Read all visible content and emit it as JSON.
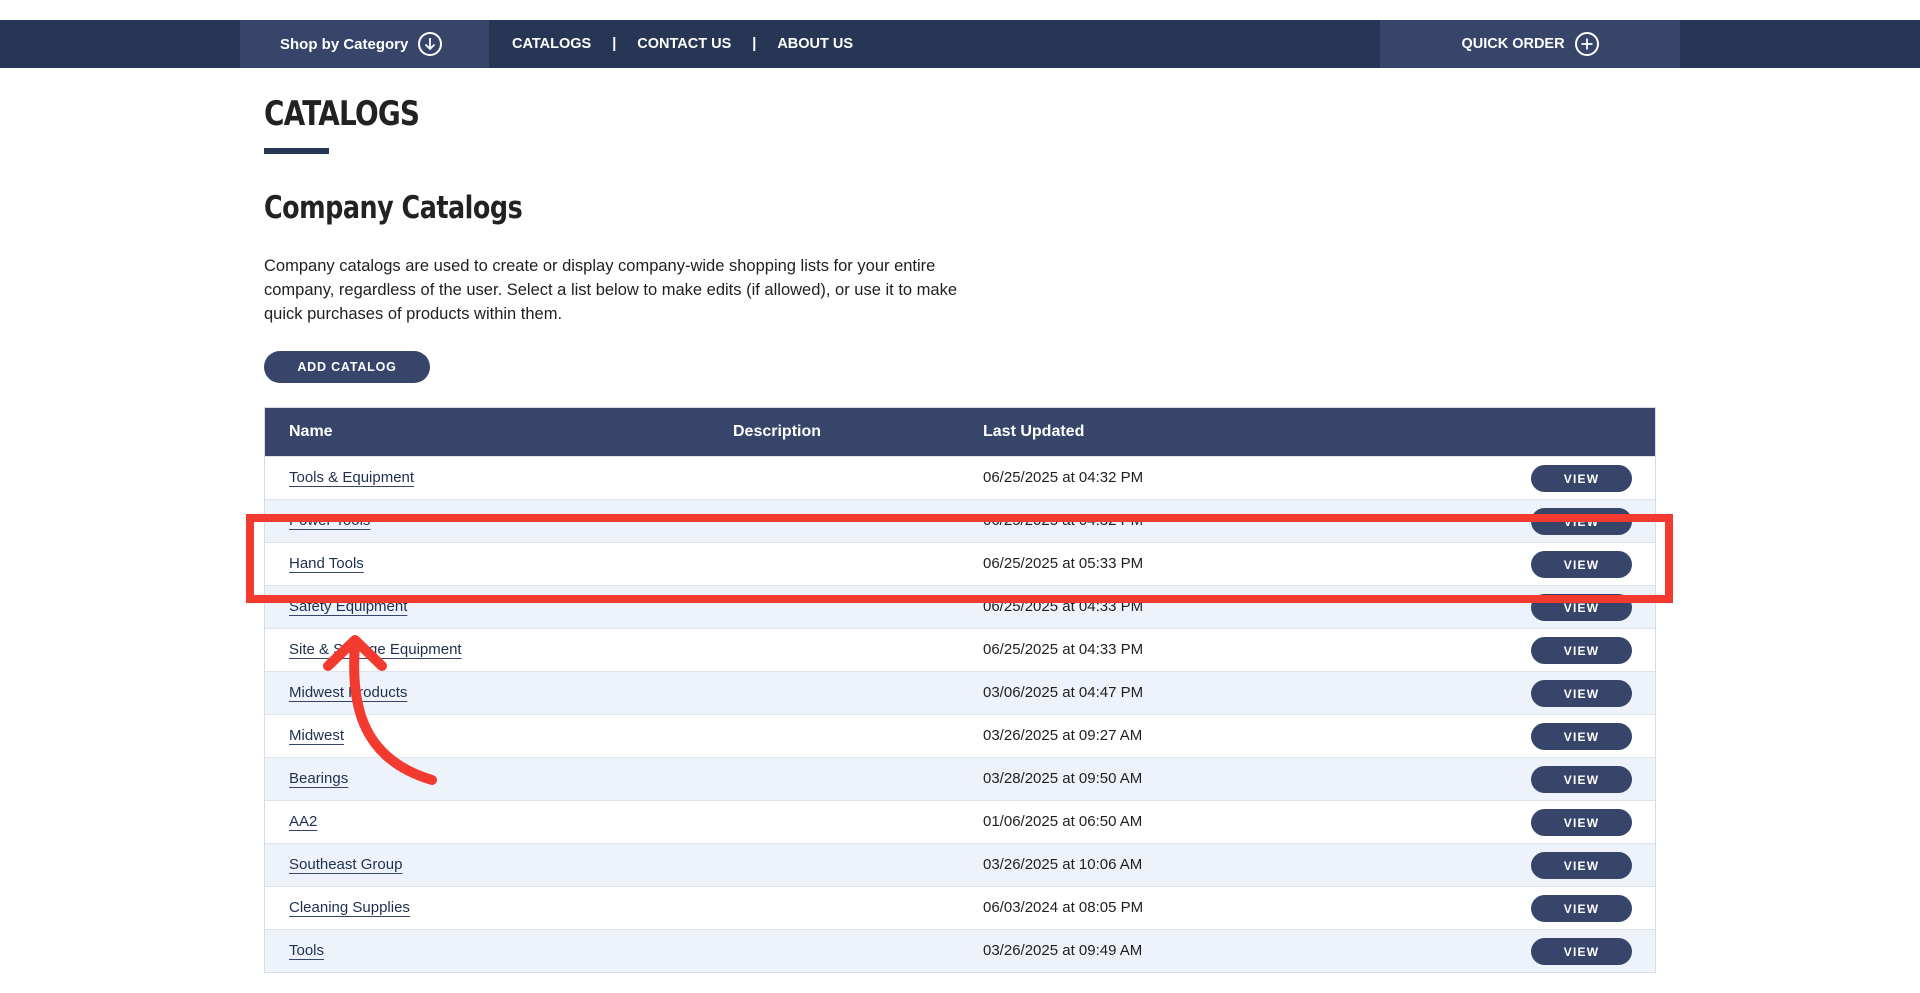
{
  "nav": {
    "shop_by_category": "Shop by Category",
    "links": [
      "CATALOGS",
      "CONTACT US",
      "ABOUT US"
    ],
    "separator": "|",
    "quick_order": "QUICK ORDER"
  },
  "page": {
    "title": "CATALOGS",
    "section_title": "Company Catalogs",
    "intro": "Company catalogs are used to create or display company-wide shopping lists for your entire company, regardless of the user. Select a list below to make edits (if allowed), or use it to make quick purchases of products within them.",
    "add_button": "ADD CATALOG"
  },
  "table": {
    "headers": {
      "name": "Name",
      "description": "Description",
      "last_updated": "Last Updated"
    },
    "view_label": "VIEW",
    "rows": [
      {
        "name": "Tools & Equipment",
        "date": "06/25/2025 at 04:32 PM"
      },
      {
        "name": "Power Tools",
        "date": "06/25/2025 at 04:32 PM"
      },
      {
        "name": "Hand Tools",
        "date": "06/25/2025 at 05:33 PM"
      },
      {
        "name": "Safety Equipment",
        "date": "06/25/2025 at 04:33 PM"
      },
      {
        "name": "Site & Storage Equipment",
        "date": "06/25/2025 at 04:33 PM"
      },
      {
        "name": "Midwest Products",
        "date": "03/06/2025 at 04:47 PM"
      },
      {
        "name": "Midwest",
        "date": "03/26/2025 at 09:27 AM"
      },
      {
        "name": "Bearings",
        "date": "03/28/2025 at 09:50 AM"
      },
      {
        "name": "AA2",
        "date": "01/06/2025 at 06:50 AM"
      },
      {
        "name": "Southeast Group",
        "date": "03/26/2025 at 10:06 AM"
      },
      {
        "name": "Cleaning Supplies",
        "date": "06/03/2024 at 08:05 PM"
      },
      {
        "name": "Tools",
        "date": "03/26/2025 at 09:49 AM"
      }
    ]
  },
  "colors": {
    "nav_bg": "#283655",
    "accent": "#37456a",
    "row_alt": "#eef2fb",
    "annotation": "#f23a2f"
  }
}
